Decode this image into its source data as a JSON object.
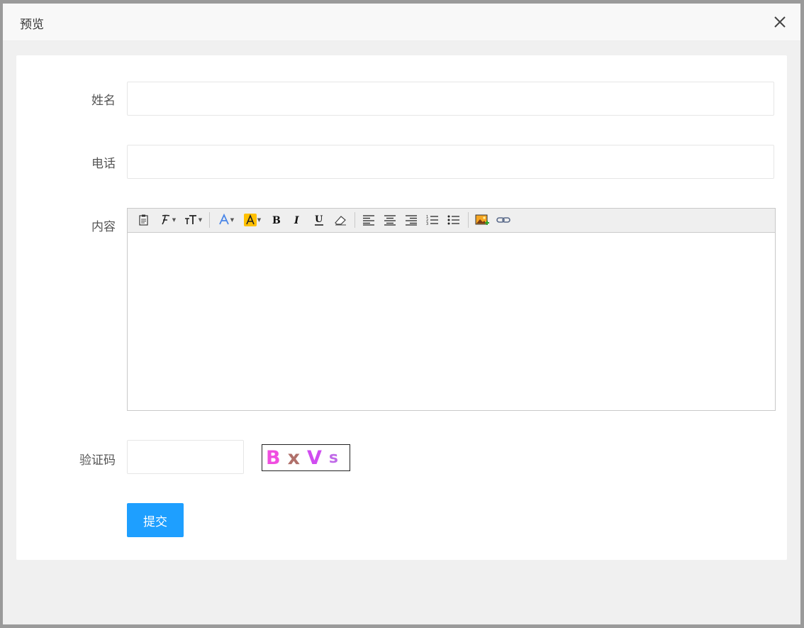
{
  "dialog": {
    "title": "预览",
    "close_icon": "close-icon"
  },
  "form": {
    "name_label": "姓名",
    "name_value": "",
    "phone_label": "电话",
    "phone_value": "",
    "content_label": "内容",
    "captcha_label": "验证码",
    "captcha_value": "",
    "captcha_chars": [
      "B",
      "x",
      "V",
      "s"
    ],
    "captcha_colors": [
      "#f04ee0",
      "#b0706a",
      "#d04cf0",
      "#c06ae8"
    ],
    "submit_label": "提交"
  },
  "editor": {
    "toolbar": [
      "paste-icon",
      "font-family-icon",
      "font-size-icon",
      "font-color-icon",
      "highlight-color-icon",
      "bold-icon",
      "italic-icon",
      "underline-icon",
      "eraser-icon",
      "align-left-icon",
      "align-center-icon",
      "align-right-icon",
      "ordered-list-icon",
      "unordered-list-icon",
      "image-icon",
      "link-icon"
    ],
    "content": ""
  },
  "colors": {
    "accent": "#1e9fff",
    "highlight": "#ffc000",
    "font_color": "#4a86e8"
  }
}
